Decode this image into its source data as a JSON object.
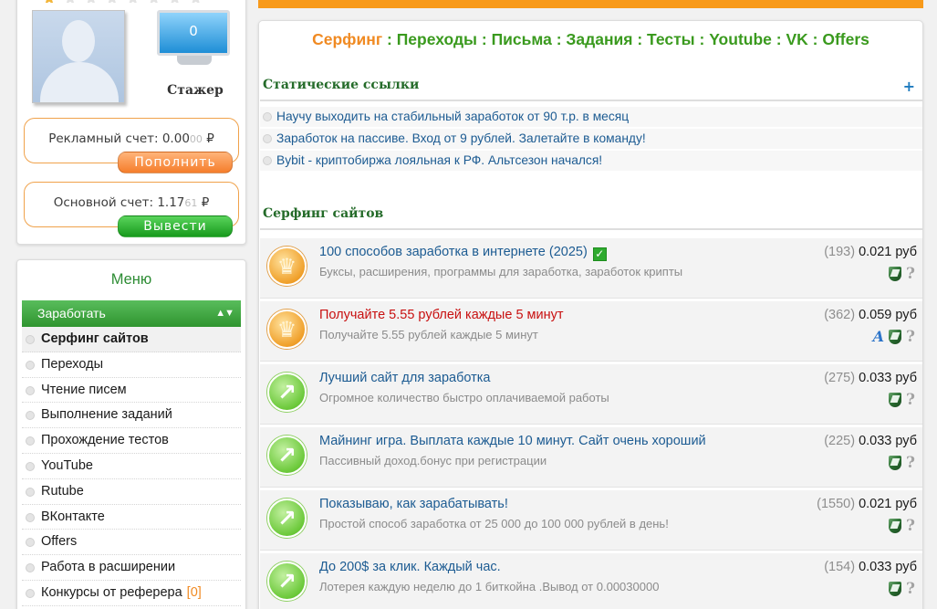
{
  "profile": {
    "stars_total": 8,
    "stars_filled": 1,
    "level_number": "0",
    "rank": "Стажер"
  },
  "accounts": {
    "ad": {
      "label": "Рекламный счет: 0.00",
      "cents": "00",
      "currency": " ₽",
      "button": "Пополнить"
    },
    "main": {
      "label": "Основной счет: 1.17",
      "cents": "61",
      "currency": " ₽",
      "button": "Вывести"
    }
  },
  "menu": {
    "title": "Меню",
    "header": "Заработать",
    "header_icon": "sort-arrows-icon",
    "items": [
      {
        "label": "Серфинг сайтов",
        "active": true,
        "count": ""
      },
      {
        "label": "Переходы",
        "count": ""
      },
      {
        "label": "Чтение писем",
        "count": ""
      },
      {
        "label": "Выполнение заданий",
        "count": ""
      },
      {
        "label": "Прохождение тестов",
        "count": ""
      },
      {
        "label": "YouTube",
        "count": ""
      },
      {
        "label": "Rutube",
        "count": ""
      },
      {
        "label": "ВКонтакте",
        "count": ""
      },
      {
        "label": "Offers",
        "count": ""
      },
      {
        "label": "Работа в расширении",
        "count": ""
      },
      {
        "label": "Конкурсы от реферера",
        "count": "[0]"
      }
    ]
  },
  "tabs": [
    {
      "label": "Серфинг",
      "active": true
    },
    {
      "label": "Переходы"
    },
    {
      "label": "Письма"
    },
    {
      "label": "Задания"
    },
    {
      "label": "Тесты"
    },
    {
      "label": "Youtube"
    },
    {
      "label": "VK"
    },
    {
      "label": "Offers"
    }
  ],
  "tab_separator": " : ",
  "static_links": {
    "title": "Статические ссылки",
    "expand": "+",
    "items": [
      "Научу выходить на стабильный заработок от 90 т.р. в месяц",
      "Заработок на пассиве. Вход от 9 рублей. Залетайте в команду!",
      "Bybit - криптобиржа лояльная к РФ. Альтсезон начался!"
    ]
  },
  "surfing": {
    "title": "Серфинг сайтов",
    "rows": [
      {
        "icon": "crown-icon",
        "title": "100 способов заработка в интернете (2025)",
        "verified": true,
        "red": false,
        "desc": "Буксы, расширения, программы для заработка, заработок крипты",
        "views": "(193)",
        "price": "0.021 руб",
        "badges": [
          "shield-icon",
          "help-icon"
        ]
      },
      {
        "icon": "crown-icon",
        "title": "Получайте 5.55 рублей каждые 5 минут",
        "verified": false,
        "red": true,
        "desc": "Получайте 5.55 рублей каждые 5 минут",
        "views": "(362)",
        "price": "0.059 руб",
        "badges": [
          "font-a-icon",
          "shield-icon",
          "help-icon"
        ]
      },
      {
        "icon": "arrow-icon",
        "title": "Лучший сайт для заработка",
        "verified": false,
        "red": false,
        "desc": "Огромное количество быстро оплачиваемой работы",
        "views": "(275)",
        "price": "0.033 руб",
        "badges": [
          "shield-icon",
          "help-icon"
        ]
      },
      {
        "icon": "arrow-icon",
        "title": "Майнинг игра. Выплата каждые 10 минут. Сайт очень хороший",
        "verified": false,
        "red": false,
        "desc": "Пассивный доход.бонус при регистрации",
        "views": "(225)",
        "price": "0.033 руб",
        "badges": [
          "shield-icon",
          "help-icon"
        ]
      },
      {
        "icon": "arrow-icon",
        "title": "Показываю, как зарабатывать!",
        "verified": false,
        "red": false,
        "desc": "Простой способ заработка от 25 000 до 100 000 рублей в день!",
        "views": "(1550)",
        "price": "0.021 руб",
        "badges": [
          "shield-icon",
          "help-icon"
        ]
      },
      {
        "icon": "arrow-icon",
        "title": "До 200$ за клик. Каждый час.",
        "verified": false,
        "red": false,
        "desc": "Лотерея каждую неделю до 1 биткойна .Вывод от 0.00030000",
        "views": "(154)",
        "price": "0.033 руб",
        "badges": [
          "shield-icon",
          "help-icon"
        ]
      }
    ]
  },
  "colors": {
    "accent_orange": "#f08a22",
    "accent_green": "#3a9a1e",
    "link_blue": "#1c5b92"
  }
}
